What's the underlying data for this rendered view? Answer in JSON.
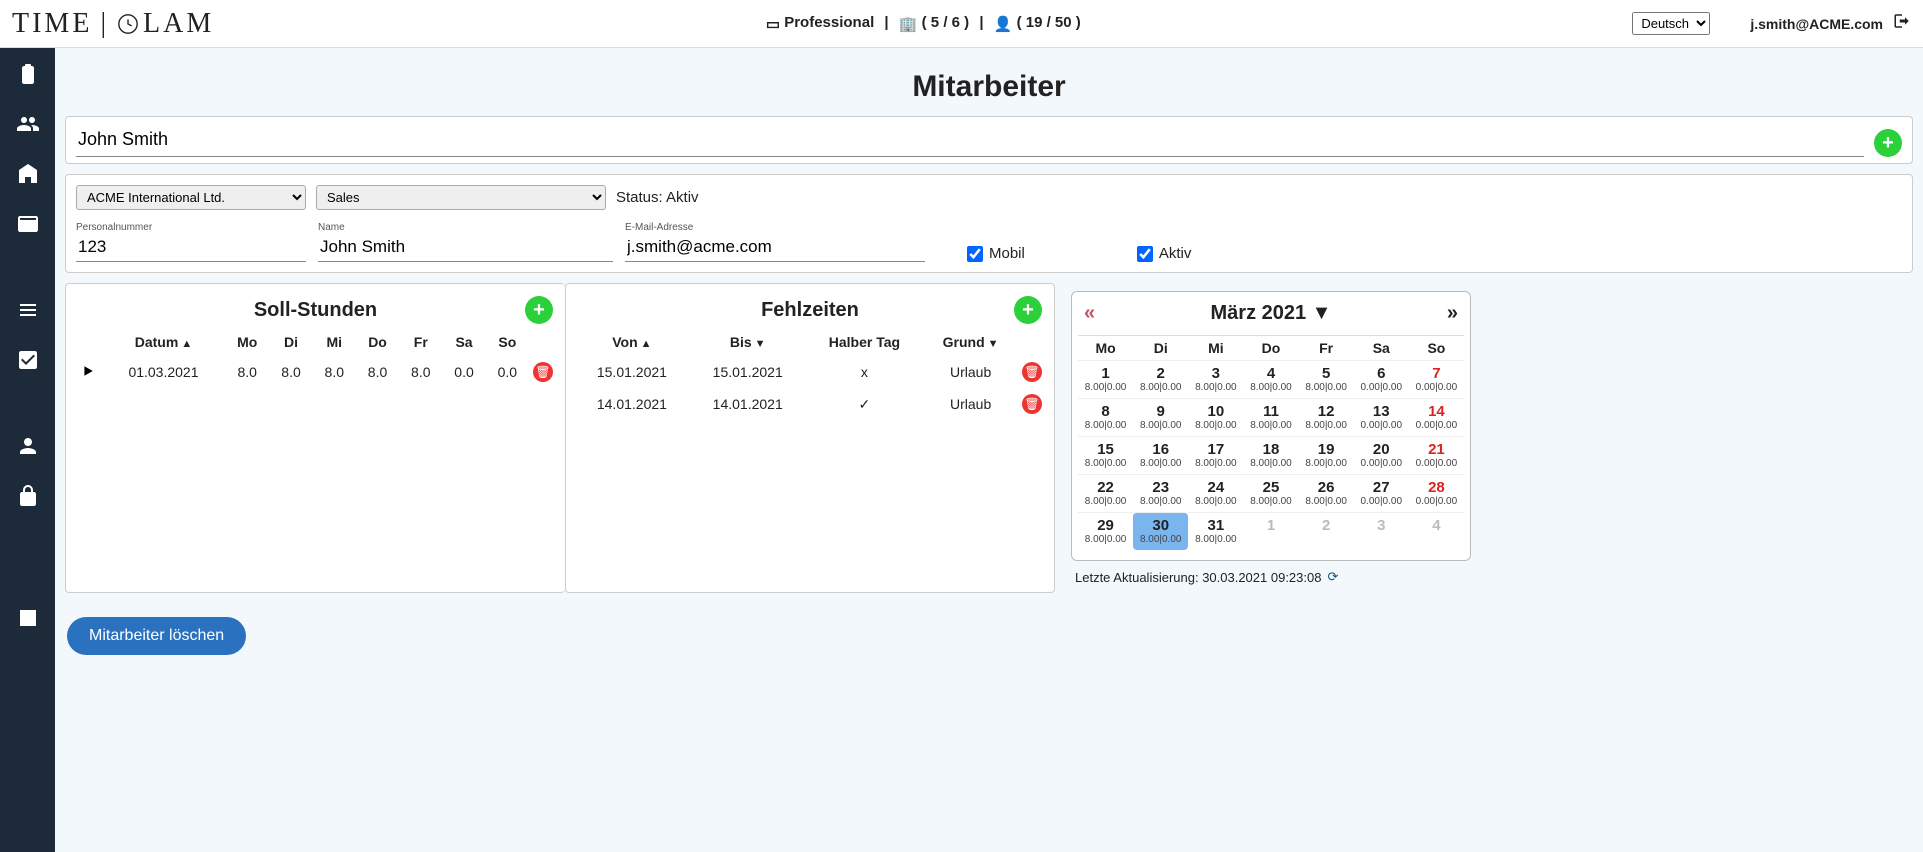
{
  "header": {
    "logo": "TIME | CLAM",
    "plan": "Professional",
    "buildings": "( 5 / 6 )",
    "users": "( 19 / 50 )",
    "language": "Deutsch",
    "user_email": "j.smith@ACME.com"
  },
  "page": {
    "title": "Mitarbeiter",
    "search_value": "John Smith",
    "delete_label": "Mitarbeiter löschen"
  },
  "detail": {
    "company": "ACME International Ltd.",
    "department": "Sales",
    "status_label": "Status: Aktiv",
    "personal_number_label": "Personalnummer",
    "personal_number": "123",
    "name_label": "Name",
    "name": "John Smith",
    "email_label": "E-Mail-Adresse",
    "email": "j.smith@acme.com",
    "mobil_label": "Mobil",
    "mobil_checked": true,
    "aktiv_label": "Aktiv",
    "aktiv_checked": true
  },
  "soll": {
    "title": "Soll-Stunden",
    "columns": {
      "datum": "Datum",
      "mo": "Mo",
      "di": "Di",
      "mi": "Mi",
      "do": "Do",
      "fr": "Fr",
      "sa": "Sa",
      "so": "So"
    },
    "rows": [
      {
        "datum": "01.03.2021",
        "mo": "8.0",
        "di": "8.0",
        "mi": "8.0",
        "do": "8.0",
        "fr": "8.0",
        "sa": "0.0",
        "so": "0.0"
      }
    ]
  },
  "fehl": {
    "title": "Fehlzeiten",
    "columns": {
      "von": "Von",
      "bis": "Bis",
      "halber": "Halber Tag",
      "grund": "Grund"
    },
    "rows": [
      {
        "von": "15.01.2021",
        "bis": "15.01.2021",
        "halber": "x",
        "grund": "Urlaub"
      },
      {
        "von": "14.01.2021",
        "bis": "14.01.2021",
        "halber": "✓",
        "grund": "Urlaub"
      }
    ]
  },
  "calendar": {
    "title": "März 2021",
    "dow": [
      "Mo",
      "Di",
      "Mi",
      "Do",
      "Fr",
      "Sa",
      "So"
    ],
    "cells": [
      {
        "d": "1",
        "s": "8.00|0.00"
      },
      {
        "d": "2",
        "s": "8.00|0.00"
      },
      {
        "d": "3",
        "s": "8.00|0.00"
      },
      {
        "d": "4",
        "s": "8.00|0.00"
      },
      {
        "d": "5",
        "s": "8.00|0.00"
      },
      {
        "d": "6",
        "s": "0.00|0.00",
        "red": false
      },
      {
        "d": "7",
        "s": "0.00|0.00",
        "red": true
      },
      {
        "d": "8",
        "s": "8.00|0.00"
      },
      {
        "d": "9",
        "s": "8.00|0.00"
      },
      {
        "d": "10",
        "s": "8.00|0.00"
      },
      {
        "d": "11",
        "s": "8.00|0.00"
      },
      {
        "d": "12",
        "s": "8.00|0.00"
      },
      {
        "d": "13",
        "s": "0.00|0.00"
      },
      {
        "d": "14",
        "s": "0.00|0.00",
        "red": true
      },
      {
        "d": "15",
        "s": "8.00|0.00"
      },
      {
        "d": "16",
        "s": "8.00|0.00"
      },
      {
        "d": "17",
        "s": "8.00|0.00"
      },
      {
        "d": "18",
        "s": "8.00|0.00"
      },
      {
        "d": "19",
        "s": "8.00|0.00"
      },
      {
        "d": "20",
        "s": "0.00|0.00"
      },
      {
        "d": "21",
        "s": "0.00|0.00",
        "red": true
      },
      {
        "d": "22",
        "s": "8.00|0.00"
      },
      {
        "d": "23",
        "s": "8.00|0.00"
      },
      {
        "d": "24",
        "s": "8.00|0.00"
      },
      {
        "d": "25",
        "s": "8.00|0.00"
      },
      {
        "d": "26",
        "s": "8.00|0.00"
      },
      {
        "d": "27",
        "s": "0.00|0.00"
      },
      {
        "d": "28",
        "s": "0.00|0.00",
        "red": true
      },
      {
        "d": "29",
        "s": "8.00|0.00"
      },
      {
        "d": "30",
        "s": "8.00|0.00",
        "today": true
      },
      {
        "d": "31",
        "s": "8.00|0.00"
      },
      {
        "d": "1",
        "s": "",
        "muted": true
      },
      {
        "d": "2",
        "s": "",
        "muted": true
      },
      {
        "d": "3",
        "s": "",
        "muted": true
      },
      {
        "d": "4",
        "s": "",
        "muted": true,
        "red": true
      }
    ],
    "last_update": "Letzte Aktualisierung: 30.03.2021 09:23:08"
  }
}
